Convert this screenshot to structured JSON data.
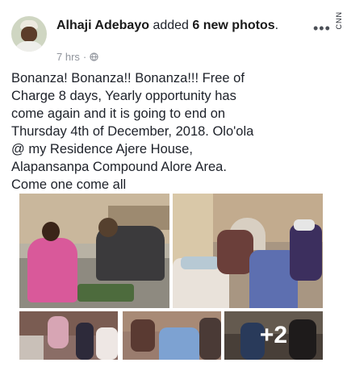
{
  "post": {
    "author": "Alhaji Adebayo",
    "action_prefix": "added",
    "action_strong": "6 new photos",
    "action_suffix": ".",
    "timestamp": "7 hrs",
    "separator": "·",
    "privacy_icon": "globe-icon",
    "more_icon": "ellipsis-icon",
    "more_glyph": "•••",
    "watermark": "CNN",
    "text_lines": [
      "Bonanza! Bonanza!! Bonanza!!! Free of",
      "Charge 8 days, Yearly opportunity has",
      "come again and it is going to end on",
      "Thursday 4th of December, 2018. Olo'ola",
      "@ my Residence Ajere House,",
      "Alapansanpa Compound Alore Area.",
      "Come one come all"
    ],
    "photo_overflow_count": "+2"
  },
  "colors": {
    "text": "#1d2129",
    "meta": "#90949c",
    "background": "#ffffff"
  }
}
